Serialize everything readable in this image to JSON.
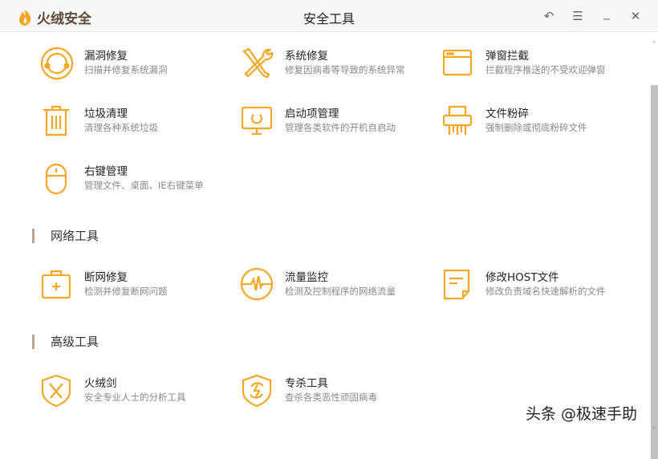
{
  "app": {
    "name": "火绒安全",
    "title": "安全工具"
  },
  "window_controls": {
    "back": "↶",
    "menu": "☰",
    "minimize": "_",
    "close": "✕"
  },
  "colors": {
    "accent": "#f5a623",
    "section_bar": "#b8a48f"
  },
  "system_tools": [
    {
      "title": "漏洞修复",
      "desc": "扫描并修复系统漏洞",
      "icon": "vulnerability-fix-icon"
    },
    {
      "title": "系统修复",
      "desc": "修复因病毒等导致的系统异常",
      "icon": "wrench-screwdriver-icon"
    },
    {
      "title": "弹窗拦截",
      "desc": "拦截程序推送的不受欢迎弹窗",
      "icon": "popup-window-icon"
    },
    {
      "title": "垃圾清理",
      "desc": "清理各种系统垃圾",
      "icon": "trash-icon"
    },
    {
      "title": "启动项管理",
      "desc": "管理各类软件的开机自启动",
      "icon": "monitor-startup-icon"
    },
    {
      "title": "文件粉碎",
      "desc": "强制删除或彻底粉碎文件",
      "icon": "shredder-icon"
    },
    {
      "title": "右键管理",
      "desc": "管理文件、桌面、IE右键菜单",
      "icon": "mouse-icon"
    }
  ],
  "network_section": {
    "title": "网络工具",
    "items": [
      {
        "title": "断网修复",
        "desc": "检测并修复断网问题",
        "icon": "first-aid-kit-icon"
      },
      {
        "title": "流量监控",
        "desc": "检测及控制程序的网络流量",
        "icon": "pulse-monitor-icon"
      },
      {
        "title": "修改HOST文件",
        "desc": "修改负责域名快速解析的文件",
        "icon": "document-icon"
      }
    ]
  },
  "advanced_section": {
    "title": "高级工具",
    "items": [
      {
        "title": "火绒剑",
        "desc": "安全专业人士的分析工具",
        "icon": "shield-swords-icon"
      },
      {
        "title": "专杀工具",
        "desc": "查杀各类恶性顽固病毒",
        "icon": "shield-bolt-icon"
      }
    ]
  },
  "scrollbar": {
    "up": "^",
    "down": "v"
  },
  "watermark": "头条 @极速手助"
}
